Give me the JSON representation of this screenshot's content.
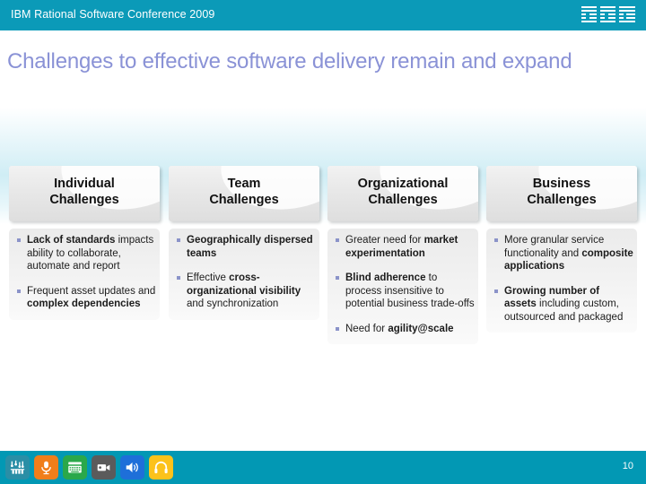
{
  "header": {
    "conference_title": "IBM Rational Software Conference 2009",
    "logo": "ibm-logo",
    "bar_color": "#0b9ab8"
  },
  "slide": {
    "title": "Challenges to effective software delivery remain and expand",
    "title_color": "#8a92d6",
    "page_number": "10"
  },
  "columns": [
    {
      "heading": "Individual\nChallenges",
      "bullets": [
        [
          {
            "text": "Lack of standards",
            "bold": true
          },
          {
            "text": " impacts ability to collaborate, automate and report",
            "bold": false
          }
        ],
        [
          {
            "text": "Frequent asset updates and ",
            "bold": false
          },
          {
            "text": "complex dependencies",
            "bold": true
          }
        ]
      ]
    },
    {
      "heading": "Team\nChallenges",
      "bullets": [
        [
          {
            "text": "Geographically dispersed teams",
            "bold": true
          }
        ],
        [
          {
            "text": "Effective ",
            "bold": false
          },
          {
            "text": "cross-organizational visibility",
            "bold": true
          },
          {
            "text": " and synchronization",
            "bold": false
          }
        ]
      ]
    },
    {
      "heading": "Organizational\nChallenges",
      "bullets": [
        [
          {
            "text": "Greater need for ",
            "bold": false
          },
          {
            "text": "market experimentation",
            "bold": true
          }
        ],
        [
          {
            "text": "Blind adherence",
            "bold": true
          },
          {
            "text": " to process insensitive to potential business trade-offs",
            "bold": false
          }
        ],
        [
          {
            "text": "Need for ",
            "bold": false
          },
          {
            "text": "agility@scale",
            "bold": true
          }
        ]
      ]
    },
    {
      "heading": "Business\nChallenges",
      "bullets": [
        [
          {
            "text": "More granular service functionality and ",
            "bold": false
          },
          {
            "text": "composite applications",
            "bold": true
          }
        ],
        [
          {
            "text": "Growing number of assets",
            "bold": true
          },
          {
            "text": " including custom, outsourced and packaged",
            "bold": false
          }
        ]
      ]
    }
  ],
  "footer": {
    "bar_color": "#0298b4",
    "icons": [
      {
        "name": "chart-bars-icon",
        "color": "#2a8ea6",
        "glyph": "chart"
      },
      {
        "name": "microphone-icon",
        "color": "#f07e1a",
        "glyph": "mic"
      },
      {
        "name": "keyboard-icon",
        "color": "#2aa84a",
        "glyph": "keyboard"
      },
      {
        "name": "video-camera-icon",
        "color": "#5b5b5b",
        "glyph": "camera"
      },
      {
        "name": "speaker-icon",
        "color": "#1e6fd9",
        "glyph": "speaker"
      },
      {
        "name": "headphones-icon",
        "color": "#fcc21b",
        "glyph": "headphones"
      }
    ]
  }
}
